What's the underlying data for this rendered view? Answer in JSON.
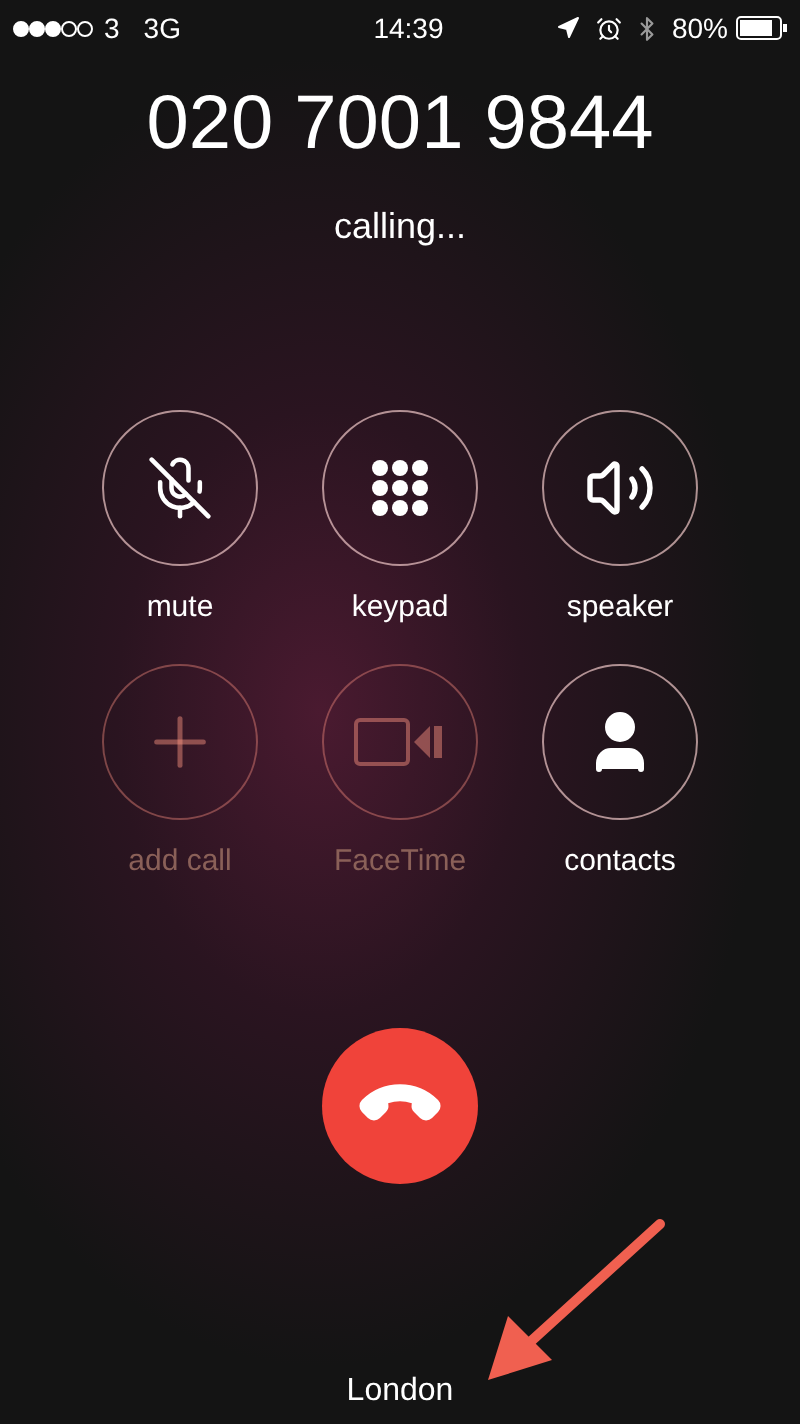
{
  "status_bar": {
    "carrier": "3",
    "network": "3G",
    "time": "14:39",
    "battery": "80%"
  },
  "call": {
    "number": "020 7001 9844",
    "status": "calling..."
  },
  "buttons": [
    {
      "kind": "mute",
      "label": "mute",
      "disabled": false
    },
    {
      "kind": "keypad",
      "label": "keypad",
      "disabled": false
    },
    {
      "kind": "speaker",
      "label": "speaker",
      "disabled": false
    },
    {
      "kind": "add",
      "label": "add call",
      "disabled": true
    },
    {
      "kind": "facetime",
      "label": "FaceTime",
      "disabled": true
    },
    {
      "kind": "contacts",
      "label": "contacts",
      "disabled": false
    }
  ],
  "location": "London"
}
